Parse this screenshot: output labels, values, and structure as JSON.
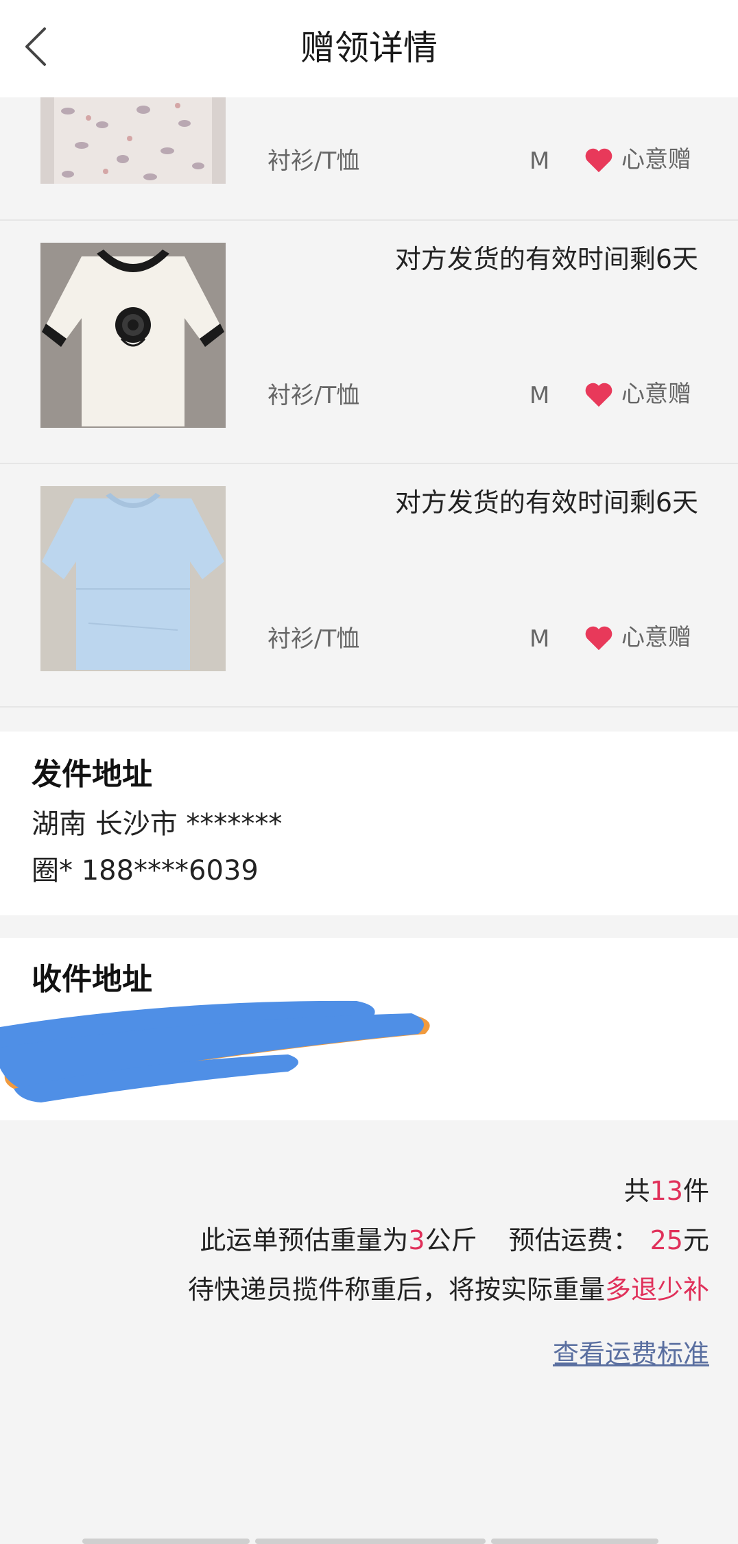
{
  "header": {
    "title": "赠领详情"
  },
  "items": [
    {
      "deadline": "",
      "category": "衬衫/T恤",
      "size": "M",
      "gift_type": "心意赠"
    },
    {
      "deadline": "对方发货的有效时间剩6天",
      "category": "衬衫/T恤",
      "size": "M",
      "gift_type": "心意赠"
    },
    {
      "deadline": "对方发货的有效时间剩6天",
      "category": "衬衫/T恤",
      "size": "M",
      "gift_type": "心意赠"
    }
  ],
  "sender": {
    "title": "发件地址",
    "address": "湖南 长沙市 *******",
    "contact": "圈* 188****6039"
  },
  "receiver": {
    "title": "收件地址"
  },
  "summary": {
    "count_prefix": "共",
    "count": "13",
    "count_suffix": "件",
    "weight_prefix": "此运单预估重量为",
    "weight": "3",
    "weight_suffix": "公斤",
    "fee_prefix": "预估运费：",
    "fee": "25",
    "fee_suffix": "元",
    "note_prefix": "待快递员揽件称重后，将按实际重量",
    "note_highlight": "多退少补",
    "fee_link": "查看运费标准"
  },
  "colors": {
    "highlight": "#e0305a",
    "link": "#5a6fa0",
    "heart": "#e8395a"
  }
}
